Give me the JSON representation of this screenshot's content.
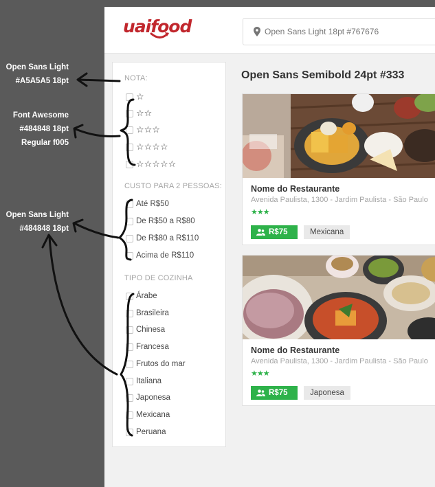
{
  "annotations": {
    "nota_font": {
      "line1": "Open Sans Light",
      "line2": "#A5A5A5 18pt"
    },
    "stars_font": {
      "line1": "Font Awesome",
      "line2": "#484848 18pt",
      "line3": "Regular f005"
    },
    "options_font": {
      "line1": "Open Sans Light",
      "line2": "#484848 18pt"
    }
  },
  "header": {
    "logo": "uaifood",
    "search_placeholder": "Open Sans Light 18pt #767676"
  },
  "filters": {
    "nota": {
      "title": "NOTA:",
      "options": [
        "☆",
        "☆☆",
        "☆☆☆",
        "☆☆☆☆",
        "☆☆☆☆☆"
      ]
    },
    "custo": {
      "title": "CUSTO PARA 2 PESSOAS:",
      "options": [
        "Até R$50",
        "De R$50 a R$80",
        "De R$80 a R$110",
        "Acima de R$110"
      ]
    },
    "cozinha": {
      "title": "TIPO DE COZINHA",
      "options": [
        "Árabe",
        "Brasileira",
        "Chinesa",
        "Francesa",
        "Frutos do mar",
        "Italiana",
        "Japonesa",
        "Mexicana",
        "Peruana"
      ]
    }
  },
  "main": {
    "title": "Open Sans Semibold 24pt #333"
  },
  "restaurants": [
    {
      "name": "Nome do Restaurante",
      "address": "Avenida Paulista, 1300 - Jardim Paulista - São Paulo",
      "rating": 3,
      "rating_stars": "★★★",
      "price": "R$75",
      "cuisine": "Mexicana"
    },
    {
      "name": "Nome do Restaurante",
      "address": "Avenida Paulista, 1300 - Jardim Paulista - São Paulo",
      "rating": 3,
      "rating_stars": "★★★",
      "price": "R$75",
      "cuisine": "Japonesa"
    }
  ],
  "colors": {
    "brand": "#c1272d",
    "accent": "#2eb24a",
    "text_dark": "#333333",
    "text_body": "#484848",
    "text_muted": "#a5a5a5",
    "placeholder": "#767676"
  }
}
